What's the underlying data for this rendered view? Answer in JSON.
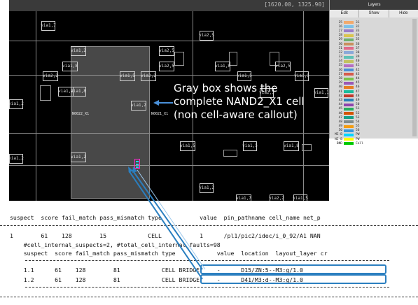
{
  "layout": {
    "zoom_readout": "[1620.00, 1325.90]",
    "vias": [
      {
        "id": "v1",
        "label": "via1,7"
      },
      {
        "id": "v2",
        "label": "via2,5"
      },
      {
        "id": "v3",
        "label": "via1,2"
      },
      {
        "id": "v4",
        "label": "via2,5"
      },
      {
        "id": "v5",
        "label": "via1,8"
      },
      {
        "id": "v6",
        "label": "via2,5"
      },
      {
        "id": "v7",
        "label": "via1,8"
      },
      {
        "id": "v8",
        "label": "via2,5"
      },
      {
        "id": "v9",
        "label": "via2,2"
      },
      {
        "id": "v10",
        "label": "via1,5"
      },
      {
        "id": "v11",
        "label": "via2,2"
      },
      {
        "id": "v12",
        "label": "via1,5"
      },
      {
        "id": "v13",
        "label": "via1,5"
      },
      {
        "id": "v14",
        "label": "via1,8"
      },
      {
        "id": "v15",
        "label": "via1,2"
      },
      {
        "id": "v16",
        "label": "via1,2"
      },
      {
        "id": "v17",
        "label": "via1,2"
      },
      {
        "id": "v18",
        "label": "via1,2"
      },
      {
        "id": "v19",
        "label": "via1,5"
      },
      {
        "id": "v20",
        "label": "via1,5"
      },
      {
        "id": "v21",
        "label": "via1,8"
      },
      {
        "id": "v22",
        "label": "via1,2"
      },
      {
        "id": "v23",
        "label": "via1,7"
      },
      {
        "id": "v24",
        "label": "via2,2"
      },
      {
        "id": "v25",
        "label": "via1,5"
      },
      {
        "id": "v26",
        "label": "via1,2"
      },
      {
        "id": "v27",
        "label": "via2,5"
      },
      {
        "id": "v28",
        "label": "via1,1"
      }
    ],
    "cell_labels": {
      "left": "N0022_X1",
      "right": "N0021_X1"
    }
  },
  "callout": {
    "line1": "Gray box shows the",
    "line2": "complete NAND2_X1 cell",
    "line3": "(non cell-aware callout)"
  },
  "layer_panel": {
    "title": "Layers",
    "tabs": [
      "Edit",
      "Show",
      "Hide"
    ],
    "layers": [
      {
        "num": "25",
        "name": "31",
        "color": "#f2a96b"
      },
      {
        "num": "26",
        "name": "32",
        "color": "#7ec1e8"
      },
      {
        "num": "27",
        "name": "33",
        "color": "#9a7cc9"
      },
      {
        "num": "28",
        "name": "34",
        "color": "#d9c44f"
      },
      {
        "num": "29",
        "name": "35",
        "color": "#6fb06f"
      },
      {
        "num": "30",
        "name": "36",
        "color": "#c98f5d"
      },
      {
        "num": "31",
        "name": "37",
        "color": "#e06a8a"
      },
      {
        "num": "32",
        "name": "38",
        "color": "#8aa8d8"
      },
      {
        "num": "33",
        "name": "39",
        "color": "#5fc2b5"
      },
      {
        "num": "34",
        "name": "40",
        "color": "#c2c25f"
      },
      {
        "num": "35",
        "name": "41",
        "color": "#b56fc2"
      },
      {
        "num": "36",
        "name": "42",
        "color": "#4b8fd6"
      },
      {
        "num": "37",
        "name": "43",
        "color": "#d65b4b"
      },
      {
        "num": "38",
        "name": "44",
        "color": "#7bc24b"
      },
      {
        "num": "39",
        "name": "45",
        "color": "#9b59b6"
      },
      {
        "num": "40",
        "name": "46",
        "color": "#e67e22"
      },
      {
        "num": "41",
        "name": "47",
        "color": "#1abc9c"
      },
      {
        "num": "42",
        "name": "48",
        "color": "#c0392b"
      },
      {
        "num": "43",
        "name": "49",
        "color": "#2980b9"
      },
      {
        "num": "44",
        "name": "50",
        "color": "#8e44ad"
      },
      {
        "num": "45",
        "name": "51",
        "color": "#27ae60"
      },
      {
        "num": "46",
        "name": "52",
        "color": "#d35400"
      },
      {
        "num": "47",
        "name": "53",
        "color": "#16a085"
      },
      {
        "num": "48",
        "name": "54",
        "color": "#7f8c8d"
      },
      {
        "num": "49",
        "name": "55",
        "color": "#f39c12"
      },
      {
        "num": "50",
        "name": "56",
        "color": "#3498db"
      },
      {
        "num": "MI-B",
        "name": "PW",
        "color": "#00d5ff"
      },
      {
        "num": "NI-B",
        "name": "PW",
        "color": "#ffff00"
      },
      {
        "num": "BND",
        "name": "Cell",
        "color": "#00c800"
      }
    ]
  },
  "report": {
    "header": "suspect  score fail_match pass_mismatch type           value  pin_pathname cell_name net_p",
    "row1": "1        61    128        15            CELL           1      /pl1/pic2/idec/i_0_92/A1 NAN",
    "meta": "    #cell_internal_suspects=2, #total_cell_internal_faults=98",
    "subheader": "    suspect  score fail_match pass_mismatch type            value  location  layout_layer cr",
    "sub1": "    1.1      61    128        81            CELL BRIDGE     -      D15/ZN:5--M3:g/1.0",
    "sub2": "    1.2      61    128        81            CELL BRIDGE     -      D41/M3:d--M3:g/1.0"
  },
  "colors": {
    "highlight": "#2b7fc0",
    "pin_marker": "#ff2bd0",
    "pin_stripes": "#21d3f0"
  }
}
